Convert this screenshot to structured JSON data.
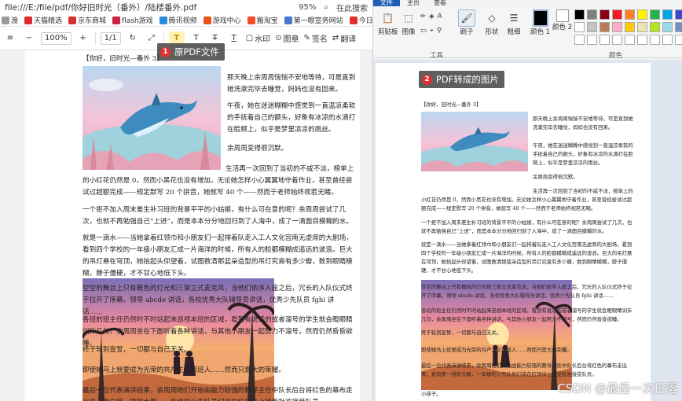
{
  "browser": {
    "url": "file:///E:/file/pdf/你好旧时光（番外）/陆楼番外.pdf",
    "zoom": "95%",
    "search_label": "在此搜索"
  },
  "bookmarks": [
    {
      "label": "渡",
      "color": "#999999"
    },
    {
      "label": "天猫精选",
      "color": "#e22b2b"
    },
    {
      "label": "京东商城",
      "color": "#d4302d"
    },
    {
      "label": "flash游戏",
      "color": "#c24"
    },
    {
      "label": "腾讯视频",
      "color": "#2b8ae0"
    },
    {
      "label": "游戏中心",
      "color": "#e8541c"
    },
    {
      "label": "搬淘宝",
      "color": "#f24c2b"
    },
    {
      "label": "第一眼宣务网站",
      "color": "#4a76c9"
    },
    {
      "label": "今日头条",
      "color": "#e02e2b"
    }
  ],
  "pdf_toolbar": {
    "zoom_value": "100%",
    "page_value": "1/1",
    "tools": [
      "水印",
      "图章",
      "签名",
      "翻译"
    ]
  },
  "left_tag": {
    "num": "1",
    "label": "原PDF文件"
  },
  "right_tag": {
    "num": "2",
    "label": "PDF转成的图片"
  },
  "document": {
    "title": "【你好，旧时光—番外 3】",
    "p1": "那天晚上余周周惴惴不安地等待，可是直到她洗漱完毕去睡觉，妈妈也没有回来。",
    "p2": "午夜，她在迷迷糊糊中感觉到一直温凉柔软的手抚着自己的额头，好象有冰凉的水滴打在脸颊上，似乎是梦里凉凉的雨丝。",
    "p3": "余周周变得很沉默。",
    "p4": "生活再一次回到了当初的不咸不淡，榜单上的小红花仍然是 0，然而小黑花也没有增加。无论她怎样小心翼翼地守着作业，甚至曾经尝试过超额完成——规定默写 20 个拼音，她就写 40 个——然而于老师始终视若无睹。",
    "p5": "一个拒不加入周末差生补习班的背景平平的小姑娘，有什么可在意的呢？余周周尝试了几次，也就不再勉强自己“上进”，而是本本分分地回归到了人海中，成了一滴面目模糊的水。",
    "p6": "就是一滴水——当她拿着红领巾和小朋友们一起排着队走入工人文化宫南无虚席的大剧场，看到四个学校的一年级小朋友汇成一片海洋的时候，所有人的脸都模糊成遥远的波浪。巨大的吊灯悬在穹顶，她抬起头仰望着，试图数清那蓝朵造型的吊灯究竟有多少瓣，数到眼睛模糊，脖子僵硬，才不甘心地低下头。",
    "p7": "空空的舞台上只有概色的灯光和三架立式麦克风，当他们依序入座之后，冗长的入队仪式终于拉开了序幕。领导 abcde 讲话，各校优秀大队辅导员讲话，优秀少先队员 fghi 讲话……",
    "p8": "各班的班主任仍然时不时站起来巡视本班的区域，看到有说话的或者溜号的学生就会瞪眼睛训斥几句，余周周坐在下面听着各种讲话，与其他小朋友一起努力不溜号，然而仍然昏昏欲睡。",
    "p9": "终于轮到宣誓，一切都与自己无关。",
    "p10": "即使她马上就要成为光荣的共产主义接班人……然而只是大的荣耀。",
    "p11": "最后一位代表演讲结束，余周周她们开始由能力较强的教导主任中队长后台将红色的幕布走出来，走向第一排的大概，一年级的少先队员们将在红领巾上接受批准接受队员。",
    "p12": "小孩子。"
  },
  "paint": {
    "tabs": [
      "文件",
      "主页",
      "查看"
    ],
    "groups": {
      "clipboard": "剪贴板",
      "image": "图像",
      "tools": "工具",
      "brushes": "刷子",
      "shapes": "形状",
      "size": "粗细",
      "color1": "颜色 1",
      "color2": "颜色 2",
      "colors_group": "颜色"
    },
    "palette": [
      "#000000",
      "#7f7f7f",
      "#880015",
      "#ed1c24",
      "#ff7f27",
      "#fff200",
      "#22b14c",
      "#00a2e8",
      "#3f48cc",
      "#a349a4",
      "#ffffff",
      "#ffffff",
      "#c3c3c3",
      "#b97a57",
      "#ffaec9",
      "#ffc90e",
      "#efe4b0",
      "#b5e61d",
      "#99d9ea",
      "#7092be",
      "#c8bfe7",
      "#ffffff",
      "#ffffff",
      "#ffffff",
      "#ffffff",
      "#ffffff",
      "#ffffff",
      "#ffffff",
      "#ffffff",
      "#ffffff",
      "#ffffff",
      "#ffffff",
      "#ffffff"
    ]
  },
  "watermark": "CSDN @最后一次日落"
}
